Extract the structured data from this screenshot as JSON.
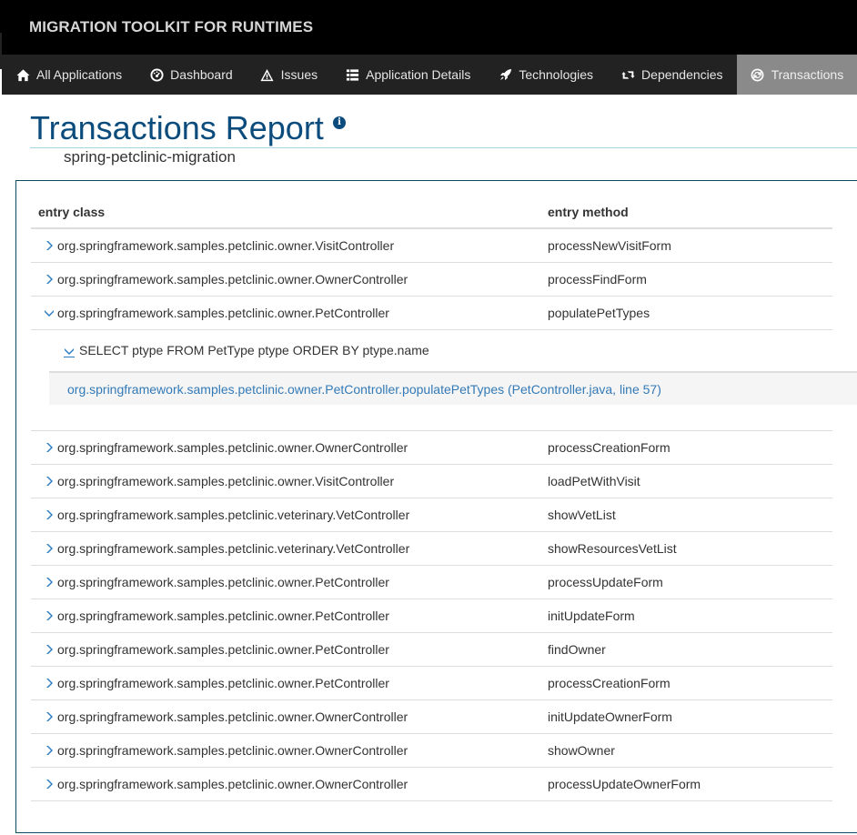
{
  "app": {
    "title": "MIGRATION TOOLKIT FOR RUNTIMES"
  },
  "nav": {
    "items": [
      {
        "label": "All Applications",
        "icon": "home-icon",
        "active": false
      },
      {
        "label": "Dashboard",
        "icon": "dashboard-icon",
        "active": false
      },
      {
        "label": "Issues",
        "icon": "warning-icon",
        "active": false
      },
      {
        "label": "Application Details",
        "icon": "list-icon",
        "active": false
      },
      {
        "label": "Technologies",
        "icon": "rocket-icon",
        "active": false
      },
      {
        "label": "Dependencies",
        "icon": "retweet-icon",
        "active": false
      },
      {
        "label": "Transactions",
        "icon": "transactions-icon",
        "active": true
      }
    ]
  },
  "page": {
    "title": "Transactions Report",
    "info_icon": "info-icon",
    "subtitle": "spring-petclinic-migration"
  },
  "table": {
    "headers": {
      "entry_class": "entry class",
      "entry_method": "entry method"
    },
    "rows": [
      {
        "entry_class": "org.springframework.samples.petclinic.owner.VisitController",
        "entry_method": "processNewVisitForm",
        "expanded": false
      },
      {
        "entry_class": "org.springframework.samples.petclinic.owner.OwnerController",
        "entry_method": "processFindForm",
        "expanded": false
      },
      {
        "entry_class": "org.springframework.samples.petclinic.owner.PetController",
        "entry_method": "populatePetTypes",
        "expanded": true,
        "detail": {
          "sql": "SELECT ptype FROM PetType ptype ORDER BY ptype.name",
          "stack_link": "org.springframework.samples.petclinic.owner.PetController.populatePetTypes (PetController.java, line 57)"
        }
      },
      {
        "entry_class": "org.springframework.samples.petclinic.owner.OwnerController",
        "entry_method": "processCreationForm",
        "expanded": false
      },
      {
        "entry_class": "org.springframework.samples.petclinic.owner.VisitController",
        "entry_method": "loadPetWithVisit",
        "expanded": false
      },
      {
        "entry_class": "org.springframework.samples.petclinic.veterinary.VetController",
        "entry_method": "showVetList",
        "expanded": false
      },
      {
        "entry_class": "org.springframework.samples.petclinic.veterinary.VetController",
        "entry_method": "showResourcesVetList",
        "expanded": false
      },
      {
        "entry_class": "org.springframework.samples.petclinic.owner.PetController",
        "entry_method": "processUpdateForm",
        "expanded": false
      },
      {
        "entry_class": "org.springframework.samples.petclinic.owner.PetController",
        "entry_method": "initUpdateForm",
        "expanded": false
      },
      {
        "entry_class": "org.springframework.samples.petclinic.owner.PetController",
        "entry_method": "findOwner",
        "expanded": false
      },
      {
        "entry_class": "org.springframework.samples.petclinic.owner.PetController",
        "entry_method": "processCreationForm",
        "expanded": false
      },
      {
        "entry_class": "org.springframework.samples.petclinic.owner.OwnerController",
        "entry_method": "initUpdateOwnerForm",
        "expanded": false
      },
      {
        "entry_class": "org.springframework.samples.petclinic.owner.OwnerController",
        "entry_method": "showOwner",
        "expanded": false
      },
      {
        "entry_class": "org.springframework.samples.petclinic.owner.OwnerController",
        "entry_method": "processUpdateOwnerForm",
        "expanded": false
      }
    ]
  },
  "colors": {
    "brand_bg": "#000000",
    "nav_bg": "#222222",
    "nav_active_bg": "#8a8a8a",
    "title": "#0b4c7d",
    "link": "#337ab7",
    "chevron": "#2a7bbf"
  }
}
